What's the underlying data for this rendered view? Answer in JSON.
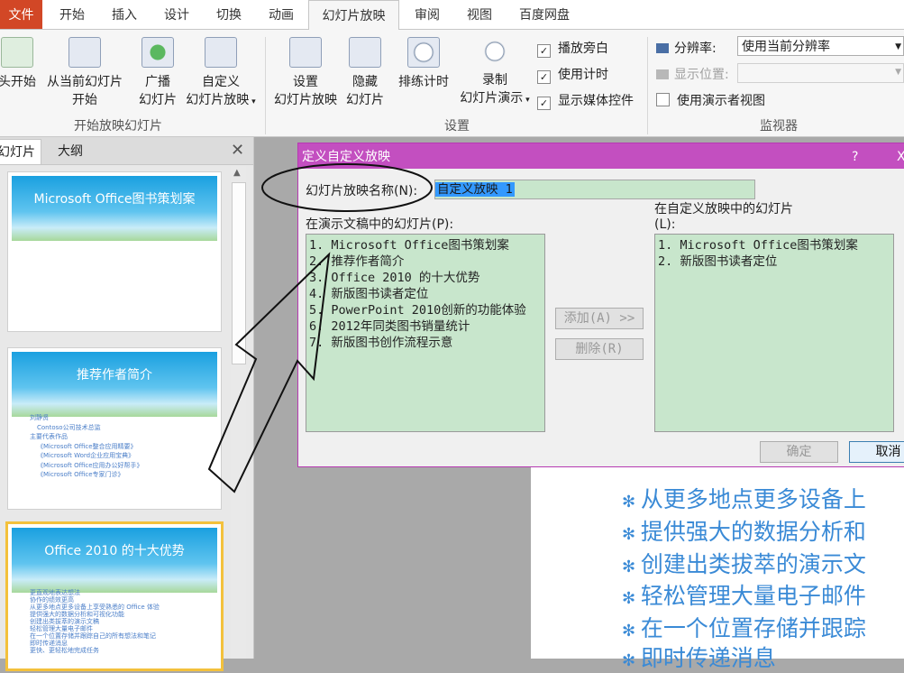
{
  "tabs": [
    "文件",
    "开始",
    "插入",
    "设计",
    "切换",
    "动画",
    "幻灯片放映",
    "审阅",
    "视图",
    "百度网盘"
  ],
  "ribbon": {
    "start_group": {
      "btn_from_start": "头开始",
      "btn_from_current_1": "从当前幻灯片",
      "btn_from_current_2": "开始",
      "btn_broadcast_1": "广播",
      "btn_broadcast_2": "幻灯片",
      "btn_custom_1": "自定义",
      "btn_custom_2": "幻灯片放映",
      "label": "开始放映幻灯片"
    },
    "setup_group": {
      "btn_setup_1": "设置",
      "btn_setup_2": "幻灯片放映",
      "btn_hide_1": "隐藏",
      "btn_hide_2": "幻灯片",
      "btn_rehearse": "排练计时",
      "btn_record_1": "录制",
      "btn_record_2": "幻灯片演示",
      "cb_narration": "播放旁白",
      "cb_timing": "使用计时",
      "cb_media": "显示媒体控件",
      "label": "设置"
    },
    "monitor_group": {
      "resolution_label": "分辨率:",
      "resolution_value": "使用当前分辨率",
      "show_on_label": "显示位置:",
      "presenter_view": "使用演示者视图",
      "label": "监视器"
    }
  },
  "leftpane": {
    "tab_slides": "幻灯片",
    "tab_outline": "大纲",
    "slide1_title": "Microsoft Office图书策划案",
    "slide2_title": "推荐作者简介",
    "slide2_bullets": [
      "刘静贤",
      "Contoso公司技术总监",
      "主要代表作品",
      "《Microsoft Office整合应用精要》",
      "《Microsoft Word企业应用宝典》",
      "《Microsoft Office应用办公好帮手》",
      "《Microsoft Office专家门诊》"
    ],
    "slide3_title": "Office 2010 的十大优势",
    "slide3_bullets": [
      "更直观地表达想法",
      "协作的绩效更高",
      "从更多地点更多设备上享受熟悉的 Office 体验",
      "提供强大的数据分析和可视化功能",
      "创建出类拔萃的演示文稿",
      "轻松管理大量电子邮件",
      "在一个位置存储并跟踪自己的所有想法和笔记",
      "即时传递消息",
      "更快、更轻松地完成任务"
    ]
  },
  "slide_bullets": [
    "从更多地点更多设备上",
    "提供强大的数据分析和",
    "创建出类拔萃的演示文",
    "轻松管理大量电子邮件",
    "在一个位置存储并跟踪",
    "即时传递消息"
  ],
  "dialog": {
    "title": "定义自定义放映",
    "help": "?",
    "close": "X",
    "name_label": "幻灯片放映名称(N):",
    "name_value": "自定义放映 1",
    "left_label": "在演示文稿中的幻灯片(P):",
    "left_items": [
      "1. Microsoft Office图书策划案",
      "2. 推荐作者简介",
      "3. Office 2010 的十大优势",
      "4. 新版图书读者定位",
      "5. PowerPoint 2010创新的功能体验",
      "6. 2012年同类图书销量统计",
      "7. 新版图书创作流程示意"
    ],
    "right_label_1": "在自定义放映中的幻灯片",
    "right_label_2": "(L):",
    "right_items": [
      "1. Microsoft Office图书策划案",
      "2. 新版图书读者定位"
    ],
    "add_btn": "添加(A) >>",
    "remove_btn": "删除(R)",
    "ok_btn": "确定",
    "cancel_btn": "取消"
  }
}
